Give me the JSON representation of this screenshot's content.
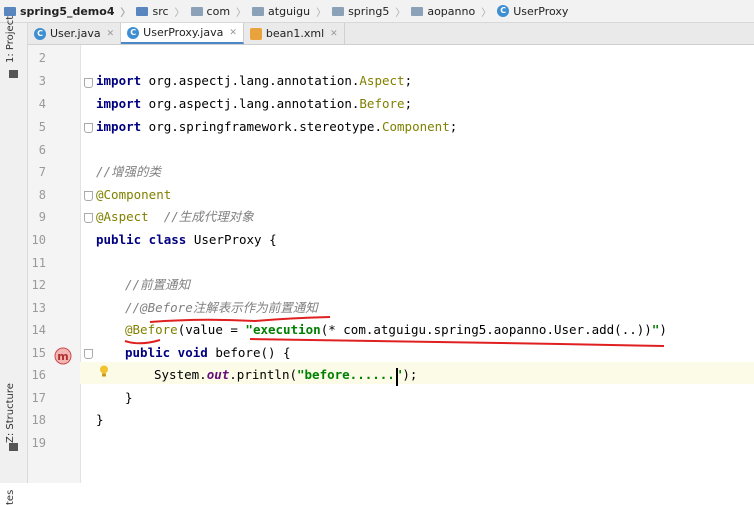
{
  "breadcrumb": [
    "spring5_demo4",
    "src",
    "com",
    "atguigu",
    "spring5",
    "aopanno",
    "UserProxy"
  ],
  "sidebar": {
    "project_label": "1: Project",
    "structure_label": "Z: Structure",
    "favorites_label": "tes"
  },
  "tabs": [
    {
      "label": "User.java",
      "active": false
    },
    {
      "label": "UserProxy.java",
      "active": true
    },
    {
      "label": "bean1.xml",
      "active": false
    }
  ],
  "line_numbers": [
    "2",
    "3",
    "4",
    "5",
    "6",
    "7",
    "8",
    "9",
    "10",
    "11",
    "12",
    "13",
    "14",
    "15",
    "16",
    "17",
    "18",
    "19"
  ],
  "code": {
    "l3_kw": "import",
    "l3_pkg": " org.aspectj.lang.annotation.",
    "l3_cls": "Aspect",
    "l3_end": ";",
    "l4_kw": "import",
    "l4_pkg": " org.aspectj.lang.annotation.",
    "l4_cls": "Before",
    "l4_end": ";",
    "l5_kw": "import",
    "l5_pkg": " org.springframework.stereotype.",
    "l5_cls": "Component",
    "l5_end": ";",
    "l7": "//增强的类",
    "l8": "@Component",
    "l9_anno": "@Aspect",
    "l9_cmt": "  //生成代理对象",
    "l10_kw": "public class",
    "l10_rest": " UserProxy {",
    "l12": "//前置通知",
    "l13": "//@Before注解表示作为前置通知",
    "l14_anno": "@Before",
    "l14_a": "(value = ",
    "l14_str": "\"execution",
    "l14_b": "(* com.atguigu.spring5.aopanno.User.add(..))",
    "l14_q": "\"",
    "l14_end": ")",
    "l15_kw": "public void",
    "l15_rest": " before() {",
    "l16_a": "System.",
    "l16_fld": "out",
    "l16_b": ".println(",
    "l16_str": "\"before......",
    "l16_q": "\"",
    "l16_end": ");",
    "l17": "}",
    "l18": "}"
  }
}
